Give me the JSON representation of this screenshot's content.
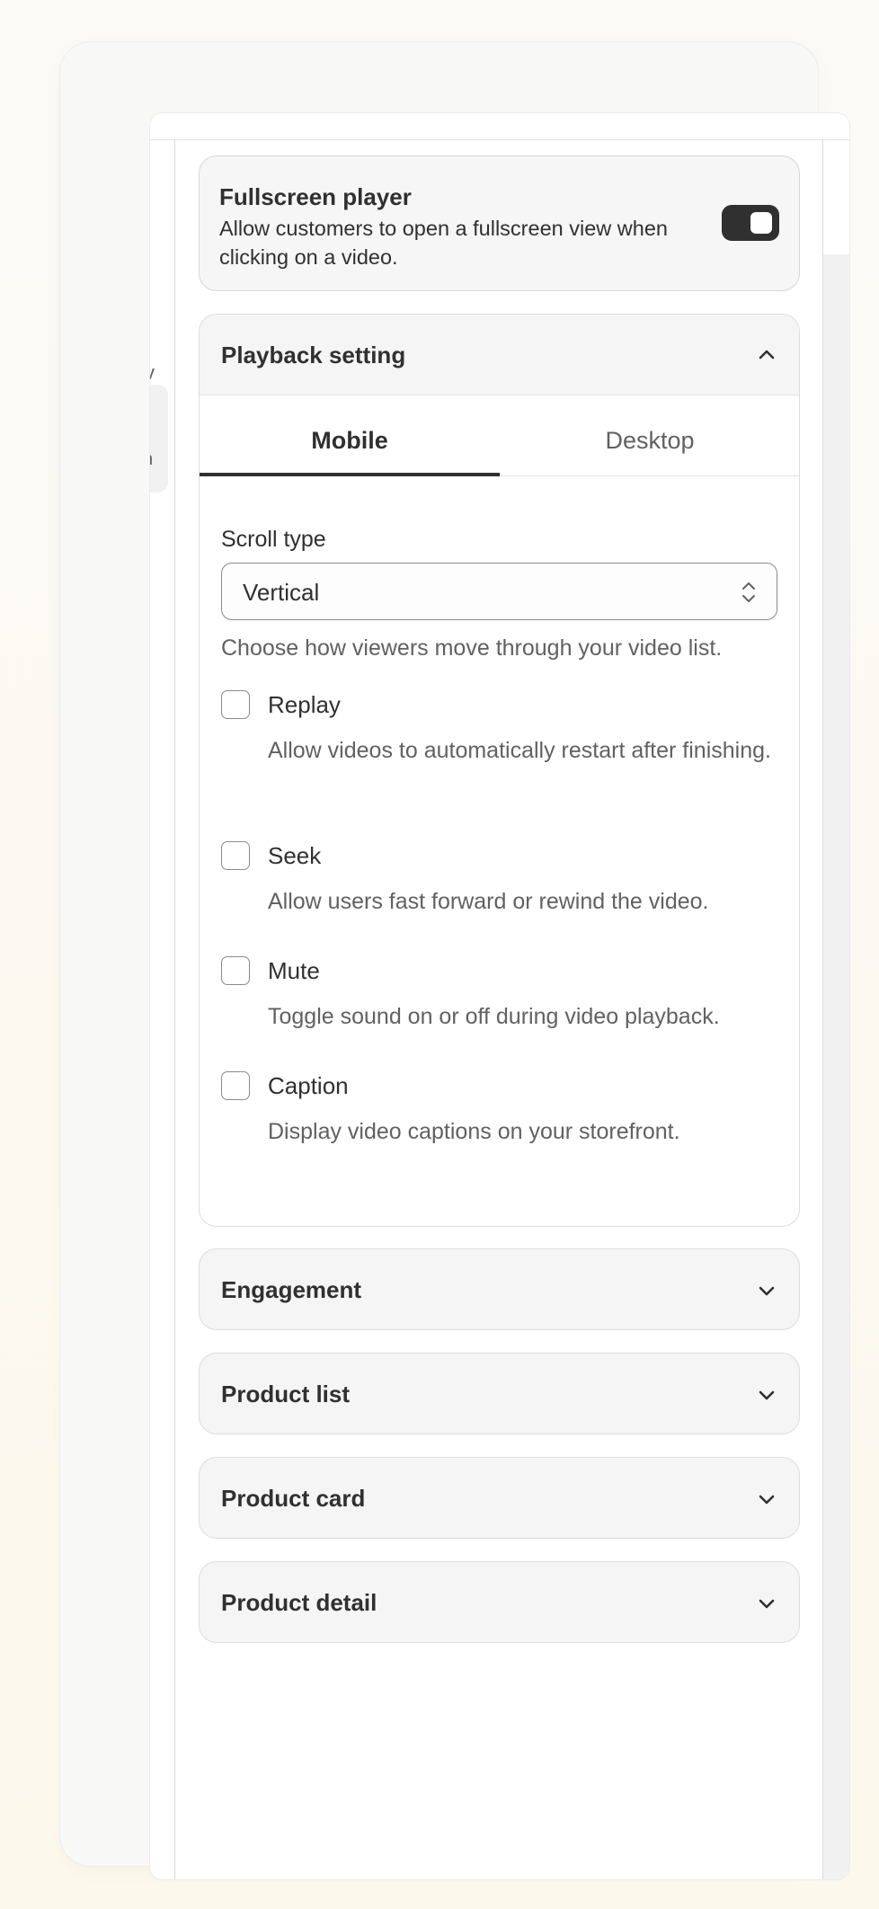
{
  "fullscreen": {
    "title": "Fullscreen player",
    "description": "Allow customers to open a fullscreen view when clicking on a video.",
    "enabled": true
  },
  "side_fragments": {
    "left_top": "v",
    "left_bottom": "n"
  },
  "playback": {
    "title": "Playback setting",
    "expanded": true,
    "tabs": [
      {
        "label": "Mobile",
        "active": true
      },
      {
        "label": "Desktop",
        "active": false
      }
    ],
    "scroll_type": {
      "label": "Scroll type",
      "value": "Vertical",
      "help": "Choose how viewers move through your video list."
    },
    "options": [
      {
        "label": "Replay",
        "description": "Allow videos to automatically restart after finishing.",
        "checked": false
      },
      {
        "label": "Seek",
        "description": "Allow users fast forward or rewind the video.",
        "checked": false
      },
      {
        "label": "Mute",
        "description": "Toggle sound on or off during video playback.",
        "checked": false
      },
      {
        "label": "Caption",
        "description": "Display video captions on your storefront.",
        "checked": false
      }
    ]
  },
  "sections": [
    {
      "title": "Engagement",
      "expanded": false
    },
    {
      "title": "Product list",
      "expanded": false
    },
    {
      "title": "Product card",
      "expanded": false
    },
    {
      "title": "Product detail",
      "expanded": false
    }
  ],
  "icons": {
    "collapse": "chevron-up-icon",
    "expand": "chevron-down-icon",
    "select": "select-updown-icon"
  },
  "colors": {
    "toggle_on": "#303030",
    "text": "#303030",
    "muted": "#616161"
  }
}
